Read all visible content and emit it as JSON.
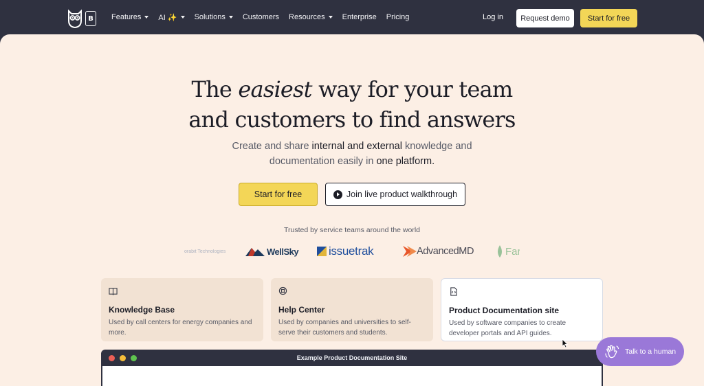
{
  "nav": {
    "items": [
      {
        "label": "Features",
        "has_dropdown": true
      },
      {
        "label": "AI ✨",
        "has_dropdown": true
      },
      {
        "label": "Solutions",
        "has_dropdown": true
      },
      {
        "label": "Customers",
        "has_dropdown": false
      },
      {
        "label": "Resources",
        "has_dropdown": true
      },
      {
        "label": "Enterprise",
        "has_dropdown": false
      },
      {
        "label": "Pricing",
        "has_dropdown": false
      }
    ],
    "login": "Log in",
    "request_demo": "Request demo",
    "start_free": "Start for free",
    "badge_letter": "B"
  },
  "hero": {
    "title_pre": "The ",
    "title_em": "easiest",
    "title_post": " way for your team",
    "title_line2": "and customers to find answers",
    "sub_1": "Create and share ",
    "sub_2": "internal and external",
    "sub_3": " knowledge and ",
    "sub_4": "documentation easily",
    "sub_5": " in ",
    "sub_6": "one platform.",
    "cta_primary": "Start for free",
    "cta_secondary": "Join live product walkthrough"
  },
  "trusted": {
    "label": "Trusted by service teams around the world",
    "logos": [
      "orabit Technologies",
      "WellSky",
      "issuetrak",
      "AdvancedMD",
      "Far"
    ]
  },
  "cards": [
    {
      "title": "Knowledge Base",
      "desc": "Used by call centers for energy companies and more.",
      "icon": "book-icon"
    },
    {
      "title": "Help Center",
      "desc": "Used by companies and universities to self-serve their customers and students.",
      "icon": "lifebuoy-icon"
    },
    {
      "title": "Product Documentation site",
      "desc": "Used by software companies to create developer portals and API guides.",
      "icon": "code-file-icon"
    }
  ],
  "window": {
    "title": "Example Product Documentation Site"
  },
  "chat": {
    "label": "Talk to a human"
  },
  "colors": {
    "nav_bg": "#2f3140",
    "hero_bg": "#fcefe5",
    "accent_yellow": "#f3d657",
    "card_bg": "#f2e2d3",
    "chat_purple": "#9a78d8"
  }
}
